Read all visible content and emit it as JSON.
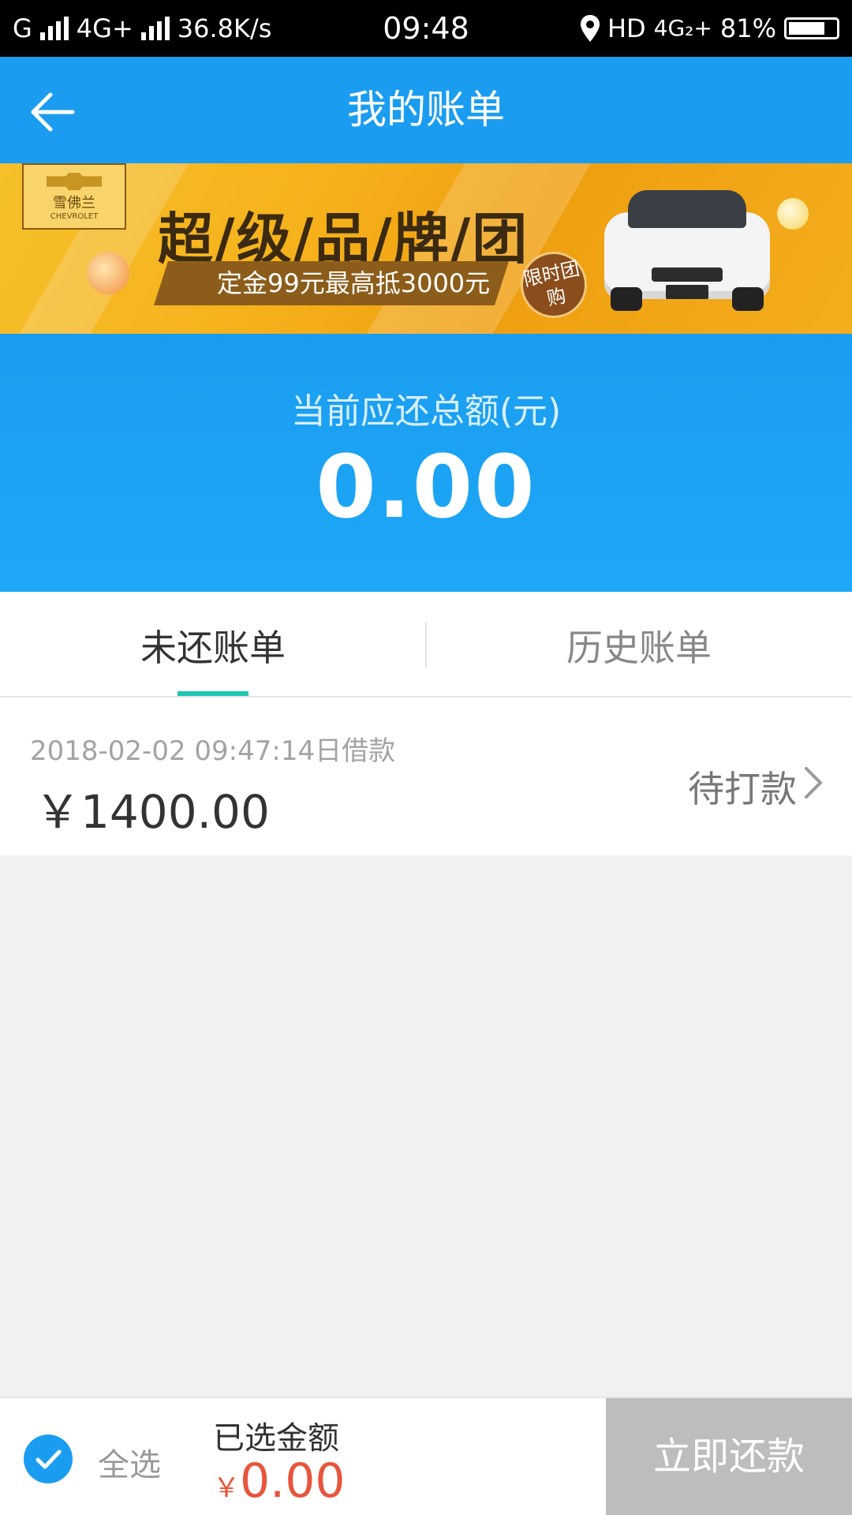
{
  "status_bar": {
    "carrier_left": "G",
    "network_mid": "4G+",
    "speed": "36.8K/s",
    "time": "09:48",
    "hd_label": "HD",
    "network_right": "4G₂+",
    "battery_percent": "81%",
    "icons": [
      "signal-icon",
      "location-icon",
      "battery-icon"
    ]
  },
  "header": {
    "title": "我的账单",
    "back_icon": "back-arrow-icon"
  },
  "banner": {
    "logo_text": "雪佛兰",
    "logo_subtext": "CHEVROLET",
    "headline": "超/级/品/牌/团",
    "subline": "定金99元最高抵3000元",
    "badge": "限时团购"
  },
  "summary": {
    "label": "当前应还总额(元)",
    "amount": "0.00"
  },
  "tabs": [
    {
      "label": "未还账单",
      "active": true
    },
    {
      "label": "历史账单",
      "active": false
    }
  ],
  "bills": [
    {
      "date": "2018-02-02 09:47:14日借款",
      "amount": "￥1400.00",
      "status": "待打款"
    }
  ],
  "bottom_bar": {
    "select_all": "全选",
    "selected_label": "已选金额",
    "currency": "￥",
    "selected_amount": "0.00",
    "pay_button": "立即还款"
  },
  "colors": {
    "primary_blue": "#1a9df0",
    "tab_indicator": "#1ec6b4",
    "amount_red": "#e8553c",
    "disabled_button": "#bdbdbd",
    "page_background": "#f1f1f1"
  }
}
